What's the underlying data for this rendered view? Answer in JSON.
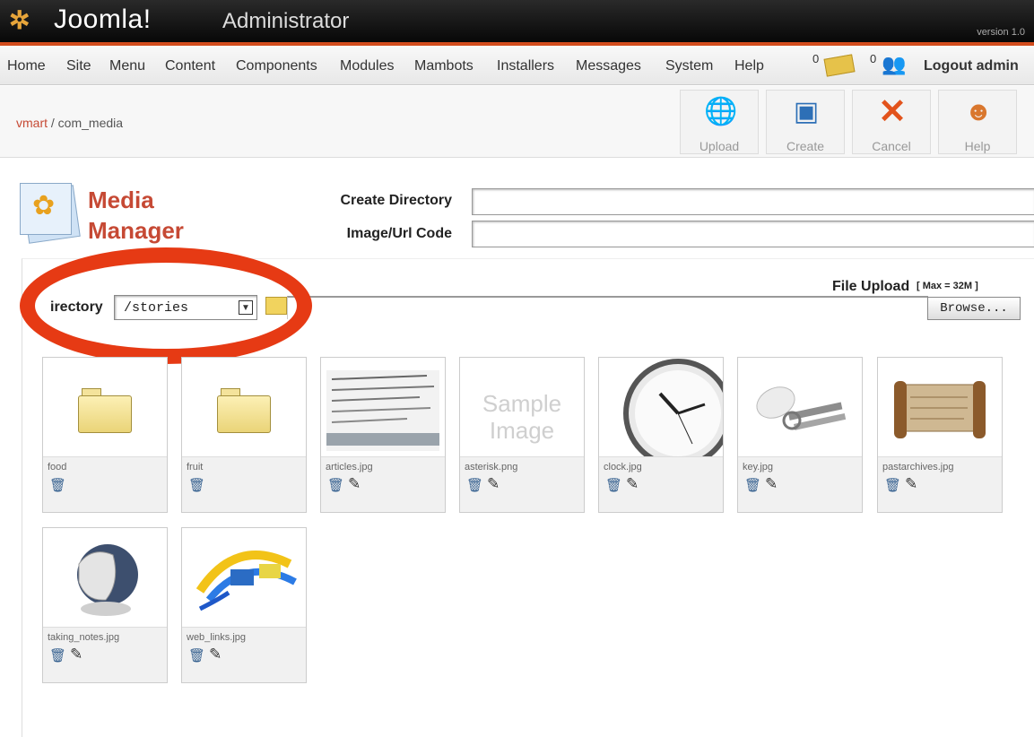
{
  "header": {
    "brand": "Joomla!",
    "app_name": "Administrator",
    "version": "version 1.0",
    "logo_icon": "joomla-logo-icon"
  },
  "menu": {
    "items": [
      "Home",
      "Site",
      "Menu",
      "Content",
      "Components",
      "Modules",
      "Mambots",
      "Installers",
      "Messages",
      "System",
      "Help"
    ],
    "messages_count": "0",
    "users_count": "0",
    "logout_label": "Logout admin"
  },
  "breadcrumb": {
    "link": "vmart",
    "separator": " / ",
    "current": "com_media"
  },
  "toolbar": [
    {
      "label": "Upload",
      "icon": "globe-upload-icon"
    },
    {
      "label": "Create",
      "icon": "create-window-icon"
    },
    {
      "label": "Cancel",
      "icon": "cancel-x-icon"
    },
    {
      "label": "Help",
      "icon": "help-person-icon"
    }
  ],
  "media_manager": {
    "title": "Media Manager",
    "create_directory_label": "Create Directory",
    "create_directory_value": "",
    "image_url_code_label": "Image/Url Code",
    "image_url_code_value": ""
  },
  "directory": {
    "label": "irectory",
    "selected": "/stories"
  },
  "file_upload": {
    "label": "File Upload",
    "max_label": "[ Max = 32M ]",
    "browse_label": "Browse..."
  },
  "media_items": [
    {
      "name": "food",
      "type": "folder",
      "editable": false
    },
    {
      "name": "fruit",
      "type": "folder",
      "editable": false
    },
    {
      "name": "articles.jpg",
      "type": "image",
      "editable": true
    },
    {
      "name": "asterisk.png",
      "type": "image",
      "editable": true,
      "placeholder_text": "Sample Image"
    },
    {
      "name": "clock.jpg",
      "type": "image",
      "editable": true
    },
    {
      "name": "key.jpg",
      "type": "image",
      "editable": true
    },
    {
      "name": "pastarchives.jpg",
      "type": "image",
      "editable": true
    },
    {
      "name": "taking_notes.jpg",
      "type": "image",
      "editable": true
    },
    {
      "name": "web_links.jpg",
      "type": "image",
      "editable": true
    }
  ],
  "colors": {
    "accent": "#c64934",
    "highlight_ring": "#e63a14",
    "header_stripe": "#d24c1c"
  }
}
